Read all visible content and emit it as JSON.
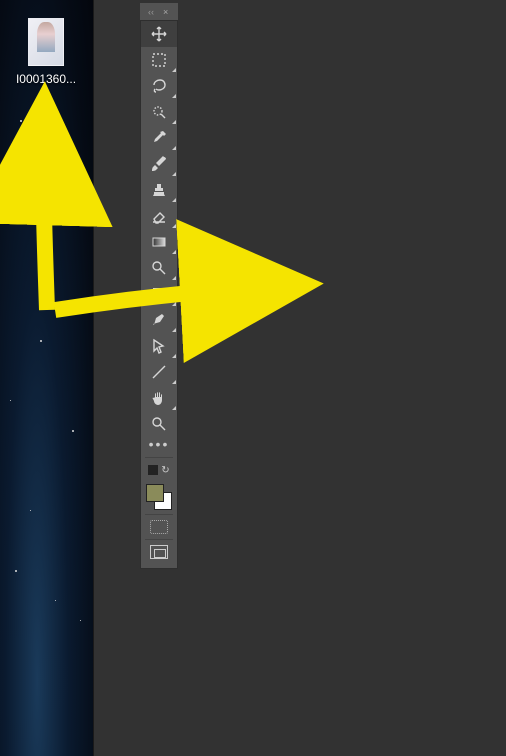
{
  "desktop": {
    "file_label": "I0001360..."
  },
  "panel": {
    "close_glyph": "×",
    "drag_glyph": "‹‹"
  },
  "tools": [
    {
      "id": "move",
      "name": "move-tool",
      "has_submenu": false
    },
    {
      "id": "marquee",
      "name": "marquee-tool",
      "has_submenu": true
    },
    {
      "id": "lasso",
      "name": "lasso-tool",
      "has_submenu": true
    },
    {
      "id": "quick-select",
      "name": "quick-selection-tool",
      "has_submenu": true
    },
    {
      "id": "eyedropper",
      "name": "eyedropper-tool",
      "has_submenu": true
    },
    {
      "id": "brush",
      "name": "brush-tool",
      "has_submenu": true
    },
    {
      "id": "stamp",
      "name": "clone-stamp-tool",
      "has_submenu": true
    },
    {
      "id": "eraser",
      "name": "eraser-tool",
      "has_submenu": true
    },
    {
      "id": "gradient",
      "name": "gradient-tool",
      "has_submenu": true
    },
    {
      "id": "dodge",
      "name": "dodge-tool",
      "has_submenu": true
    },
    {
      "id": "type",
      "name": "type-tool",
      "has_submenu": true
    },
    {
      "id": "pen",
      "name": "pen-tool",
      "has_submenu": true
    },
    {
      "id": "path-select",
      "name": "path-selection-tool",
      "has_submenu": true
    },
    {
      "id": "line",
      "name": "line-tool",
      "has_submenu": true
    },
    {
      "id": "hand",
      "name": "hand-tool",
      "has_submenu": true
    },
    {
      "id": "zoom",
      "name": "zoom-tool",
      "has_submenu": false
    }
  ],
  "swatches": {
    "foreground": "#8a8b5a",
    "background": "#ffffff"
  },
  "annotations": {
    "color": "#f5e400"
  }
}
